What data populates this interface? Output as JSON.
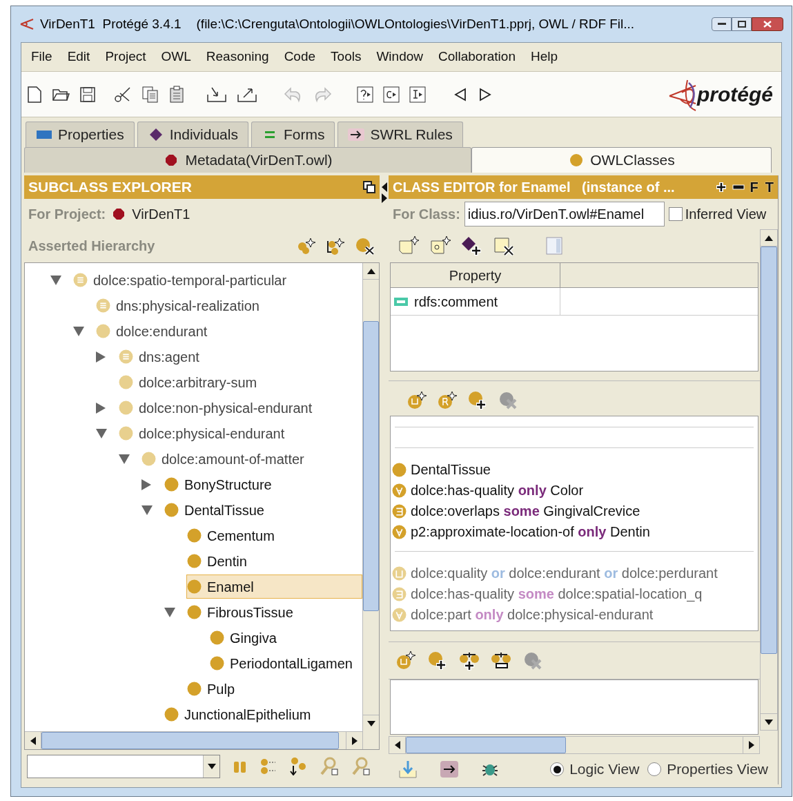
{
  "window": {
    "title": "VirDenT1  Protégé 3.4.1",
    "subtitle": "(file:\\C:\\Crenguta\\Ontologii\\OWLOntologies\\VirDenT1.pprj, OWL / RDF Fil..."
  },
  "menu": [
    "File",
    "Edit",
    "Project",
    "OWL",
    "Reasoning",
    "Code",
    "Tools",
    "Window",
    "Collaboration",
    "Help"
  ],
  "toolbar": {
    "undo": {
      "disabled": true
    },
    "redo": {
      "disabled": true
    }
  },
  "logo": {
    "text": "protégé"
  },
  "tab_rows": [
    [
      {
        "label": "Properties",
        "kind": "property",
        "selected": false
      },
      {
        "label": "Individuals",
        "kind": "individual",
        "selected": false
      },
      {
        "label": "Forms",
        "kind": "form",
        "selected": false
      },
      {
        "label": "SWRL Rules",
        "kind": "rule",
        "selected": false
      }
    ],
    [
      {
        "label": "Metadata(VirDenT.owl)",
        "kind": "metadata",
        "selected": false
      },
      {
        "label": "OWLClasses",
        "kind": "class",
        "selected": true
      }
    ]
  ],
  "subclass_explorer": {
    "title": "SUBCLASS EXPLORER",
    "project_label": "For Project:",
    "project": "VirDenT1",
    "hierarchy_label": "Asserted Hierarchy",
    "tree": [
      {
        "label": "dolce:spatio-temporal-particular",
        "kind": "defined",
        "imported": true,
        "expanded": true,
        "selected": false,
        "children": [
          {
            "label": "dns:physical-realization",
            "kind": "defined",
            "imported": true,
            "selected": false
          },
          {
            "label": "dolce:endurant",
            "kind": "primitive",
            "imported": true,
            "expanded": true,
            "selected": false,
            "children": [
              {
                "label": "dns:agent",
                "kind": "defined",
                "imported": true,
                "expanded": false,
                "selected": false
              },
              {
                "label": "dolce:arbitrary-sum",
                "kind": "primitive",
                "imported": true,
                "selected": false
              },
              {
                "label": "dolce:non-physical-endurant",
                "kind": "primitive",
                "imported": true,
                "expanded": false,
                "selected": false
              },
              {
                "label": "dolce:physical-endurant",
                "kind": "primitive",
                "imported": true,
                "expanded": true,
                "selected": false,
                "children": [
                  {
                    "label": "dolce:amount-of-matter",
                    "kind": "primitive",
                    "imported": true,
                    "expanded": true,
                    "selected": false,
                    "children": [
                      {
                        "label": "BonyStructure",
                        "kind": "primitive",
                        "imported": false,
                        "expanded": false,
                        "selected": false
                      },
                      {
                        "label": "DentalTissue",
                        "kind": "primitive",
                        "imported": false,
                        "expanded": true,
                        "selected": false,
                        "children": [
                          {
                            "label": "Cementum",
                            "kind": "primitive",
                            "imported": false,
                            "selected": false
                          },
                          {
                            "label": "Dentin",
                            "kind": "primitive",
                            "imported": false,
                            "selected": false
                          },
                          {
                            "label": "Enamel",
                            "kind": "primitive",
                            "imported": false,
                            "selected": true
                          },
                          {
                            "label": "FibrousTissue",
                            "kind": "primitive",
                            "imported": false,
                            "expanded": true,
                            "selected": false,
                            "children": [
                              {
                                "label": "Gingiva",
                                "kind": "primitive",
                                "imported": false,
                                "selected": false
                              },
                              {
                                "label": "PeriodontalLigamen",
                                "kind": "primitive",
                                "imported": false,
                                "selected": false
                              }
                            ]
                          },
                          {
                            "label": "Pulp",
                            "kind": "primitive",
                            "imported": false,
                            "selected": false
                          }
                        ]
                      },
                      {
                        "label": "JunctionalEpithelium",
                        "kind": "primitive",
                        "imported": false,
                        "selected": false
                      }
                    ]
                  }
                ]
              }
            ]
          }
        ]
      }
    ]
  },
  "class_editor": {
    "title": "CLASS EDITOR for Enamel   (instance of ...",
    "header_buttons": [
      "F",
      "T"
    ],
    "class_label": "For Class:",
    "class_value": "idius.ro/VirDenT.owl#Enamel",
    "inferred_view": {
      "label": "Inferred View",
      "checked": false
    },
    "annotations": {
      "columns": [
        "Property"
      ],
      "rows": [
        {
          "property": "rdfs:comment"
        }
      ]
    },
    "conditions": [
      {
        "kind": "class",
        "inherited": false,
        "parts": [
          {
            "text": "DentalTissue",
            "kind": "name"
          }
        ]
      },
      {
        "kind": "all",
        "inherited": false,
        "parts": [
          {
            "text": "dolce:has-quality",
            "kind": "name"
          },
          {
            "text": "only",
            "kind": "keyword"
          },
          {
            "text": "Color",
            "kind": "name"
          }
        ]
      },
      {
        "kind": "some",
        "inherited": false,
        "parts": [
          {
            "text": "dolce:overlaps",
            "kind": "name"
          },
          {
            "text": "some",
            "kind": "keyword"
          },
          {
            "text": "GingivalCrevice",
            "kind": "name"
          }
        ]
      },
      {
        "kind": "all",
        "inherited": false,
        "parts": [
          {
            "text": "p2:approximate-location-of",
            "kind": "name"
          },
          {
            "text": "only",
            "kind": "keyword"
          },
          {
            "text": "Dentin",
            "kind": "name"
          }
        ]
      },
      {
        "kind": "union",
        "inherited": true,
        "parts": [
          {
            "text": "dolce:quality",
            "kind": "name"
          },
          {
            "text": "or",
            "kind": "operator"
          },
          {
            "text": "dolce:endurant",
            "kind": "name"
          },
          {
            "text": "or",
            "kind": "operator"
          },
          {
            "text": "dolce:perdurant",
            "kind": "name"
          }
        ]
      },
      {
        "kind": "some",
        "inherited": true,
        "parts": [
          {
            "text": "dolce:has-quality",
            "kind": "name"
          },
          {
            "text": "some",
            "kind": "keyword"
          },
          {
            "text": "dolce:spatial-location_q",
            "kind": "name"
          }
        ]
      },
      {
        "kind": "all",
        "inherited": true,
        "parts": [
          {
            "text": "dolce:part",
            "kind": "name"
          },
          {
            "text": "only",
            "kind": "keyword"
          },
          {
            "text": "dolce:physical-endurant",
            "kind": "name"
          }
        ]
      }
    ],
    "views": [
      {
        "label": "Logic View",
        "selected": true
      },
      {
        "label": "Properties View",
        "selected": false
      }
    ]
  }
}
